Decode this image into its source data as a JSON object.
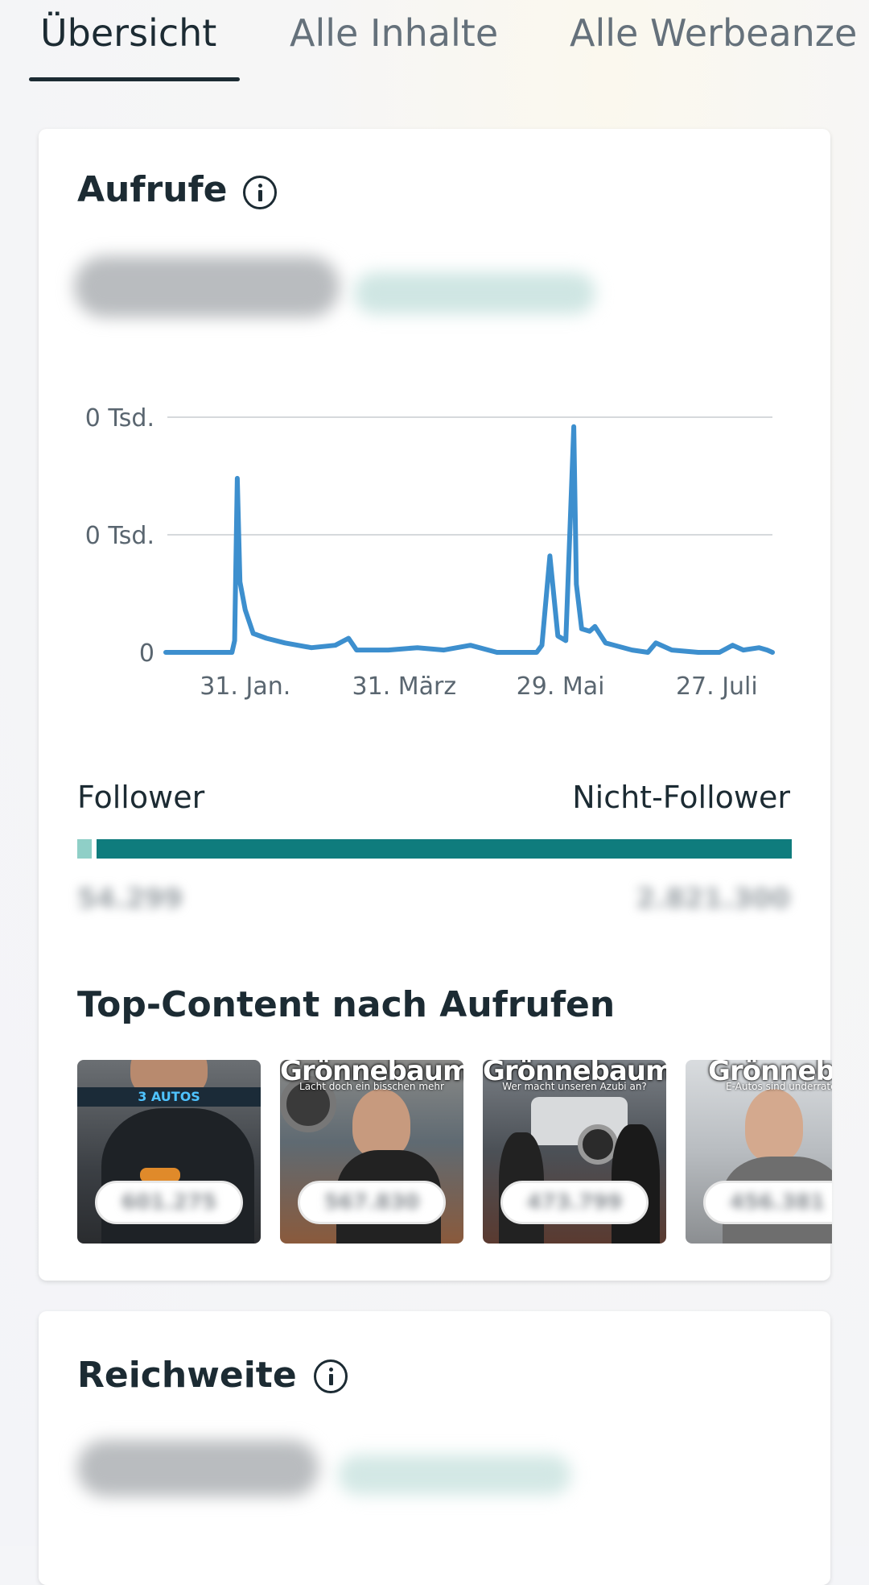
{
  "tabs": [
    {
      "label": "Übersicht",
      "active": true
    },
    {
      "label": "Alle Inhalte",
      "active": false
    },
    {
      "label": "Alle Werbeanze",
      "active": false
    }
  ],
  "views_card": {
    "title": "Aufrufe",
    "info_icon": "info-icon",
    "total_value_hidden": true,
    "chart_data": {
      "type": "line",
      "xlabel": "",
      "ylabel": "",
      "y_tick_labels": [
        "0",
        "0 Tsd.",
        "0 Tsd."
      ],
      "x_tick_labels": [
        "31. Jan.",
        "31. März",
        "29. Mai",
        "27. Juli"
      ],
      "ylim": [
        0,
        1
      ],
      "x_range": [
        "2024-01-01",
        "2024-08-17"
      ],
      "series": [
        {
          "color": "#3d8fce",
          "points": [
            [
              "2024-01-01",
              0.0
            ],
            [
              "2024-01-10",
              0.0
            ],
            [
              "2024-01-20",
              0.0
            ],
            [
              "2024-01-26",
              0.0
            ],
            [
              "2024-01-27",
              0.05
            ],
            [
              "2024-01-28",
              0.74
            ],
            [
              "2024-01-29",
              0.3
            ],
            [
              "2024-01-31",
              0.18
            ],
            [
              "2024-02-03",
              0.08
            ],
            [
              "2024-02-08",
              0.06
            ],
            [
              "2024-02-15",
              0.04
            ],
            [
              "2024-02-25",
              0.02
            ],
            [
              "2024-03-05",
              0.03
            ],
            [
              "2024-03-10",
              0.06
            ],
            [
              "2024-03-13",
              0.01
            ],
            [
              "2024-03-25",
              0.01
            ],
            [
              "2024-04-05",
              0.02
            ],
            [
              "2024-04-15",
              0.01
            ],
            [
              "2024-04-25",
              0.03
            ],
            [
              "2024-05-05",
              0.0
            ],
            [
              "2024-05-15",
              0.0
            ],
            [
              "2024-05-20",
              0.0
            ],
            [
              "2024-05-22",
              0.03
            ],
            [
              "2024-05-25",
              0.41
            ],
            [
              "2024-05-28",
              0.07
            ],
            [
              "2024-05-31",
              0.05
            ],
            [
              "2024-06-03",
              0.96
            ],
            [
              "2024-06-04",
              0.29
            ],
            [
              "2024-06-06",
              0.1
            ],
            [
              "2024-06-09",
              0.09
            ],
            [
              "2024-06-11",
              0.11
            ],
            [
              "2024-06-15",
              0.04
            ],
            [
              "2024-06-25",
              0.01
            ],
            [
              "2024-07-01",
              0.0
            ],
            [
              "2024-07-04",
              0.04
            ],
            [
              "2024-07-10",
              0.01
            ],
            [
              "2024-07-20",
              0.0
            ],
            [
              "2024-07-28",
              0.0
            ],
            [
              "2024-08-02",
              0.03
            ],
            [
              "2024-08-06",
              0.01
            ],
            [
              "2024-08-12",
              0.02
            ],
            [
              "2024-08-15",
              0.01
            ],
            [
              "2024-08-17",
              0.0
            ]
          ]
        }
      ]
    },
    "follower_split": {
      "follower_label": "Follower",
      "non_follower_label": "Nicht-Follower",
      "follower_value": "54.299",
      "non_follower_value": "2.821.300",
      "follower_color": "#8fcfc7",
      "non_follower_color": "#0f7c7d"
    },
    "top_content_title": "Top-Content nach Aufrufen",
    "thumbnails": [
      {
        "banner": "3 AUTOS",
        "brand": "",
        "caption": "",
        "count": "601.275"
      },
      {
        "banner": "",
        "brand": "Grönnebaum",
        "caption": "Lacht doch ein bisschen mehr",
        "count": "567.830"
      },
      {
        "banner": "",
        "brand": "Grönnebaum",
        "caption": "Wer macht unseren Azubi an?",
        "count": "473.799"
      },
      {
        "banner": "",
        "brand": "Grönnebau",
        "caption": "E-Autos sind underrated!",
        "count": "456.381"
      }
    ]
  },
  "reach_card": {
    "title": "Reichweite",
    "info_icon": "info-icon",
    "total_value_hidden": true
  }
}
